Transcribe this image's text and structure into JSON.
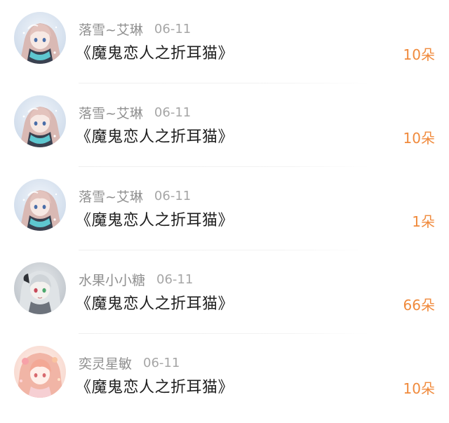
{
  "records": [
    {
      "user": "落雪~艾琳",
      "date": "06-11",
      "gift": "《魔鬼恋人之折耳猫》",
      "count": "10朵",
      "avatar_icon": "anime-girl-blue-scarf"
    },
    {
      "user": "落雪~艾琳",
      "date": "06-11",
      "gift": "《魔鬼恋人之折耳猫》",
      "count": "10朵",
      "avatar_icon": "anime-girl-blue-scarf"
    },
    {
      "user": "落雪~艾琳",
      "date": "06-11",
      "gift": "《魔鬼恋人之折耳猫》",
      "count": "1朵",
      "avatar_icon": "anime-girl-blue-scarf"
    },
    {
      "user": "水果小小糖",
      "date": "06-11",
      "gift": "《魔鬼恋人之折耳猫》",
      "count": "66朵",
      "avatar_icon": "anime-girl-silver-hair"
    },
    {
      "user": "奕灵星敏",
      "date": "06-11",
      "gift": "《魔鬼恋人之折耳猫》",
      "count": "10朵",
      "avatar_icon": "anime-girl-pink-hair"
    }
  ],
  "colors": {
    "count_accent": "#f08a3c",
    "username": "#8f8f8f",
    "date": "#a6a6a6",
    "gift_text": "#1f1f1f"
  }
}
